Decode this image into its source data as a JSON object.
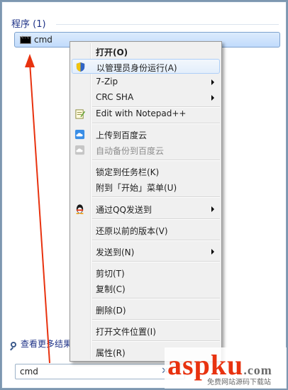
{
  "start_menu": {
    "section_header": "程序 (1)",
    "program_item": {
      "label": "cmd"
    },
    "see_more": "查看更多结果",
    "search": {
      "value": "cmd"
    }
  },
  "context_menu": {
    "items": [
      {
        "label": "打开(O)",
        "icon": "none",
        "submenu": false
      },
      {
        "label": "以管理员身份运行(A)",
        "icon": "uac-shield-icon",
        "submenu": false
      },
      {
        "label": "7-Zip",
        "icon": "none",
        "submenu": true
      },
      {
        "label": "CRC SHA",
        "icon": "none",
        "submenu": true
      },
      {
        "label": "Edit with Notepad++",
        "icon": "notepad-plus-plus-icon",
        "submenu": false
      },
      {
        "label": "上传到百度云",
        "icon": "baidu-cloud-icon",
        "submenu": false
      },
      {
        "label": "自动备份到百度云",
        "icon": "baidu-cloud-icon",
        "submenu": false
      },
      {
        "label": "锁定到任务栏(K)",
        "icon": "none",
        "submenu": false
      },
      {
        "label": "附到「开始」菜单(U)",
        "icon": "none",
        "submenu": false
      },
      {
        "label": "通过QQ发送到",
        "icon": "qq-penguin-icon",
        "submenu": true
      },
      {
        "label": "还原以前的版本(V)",
        "icon": "none",
        "submenu": false
      },
      {
        "label": "发送到(N)",
        "icon": "none",
        "submenu": true
      },
      {
        "label": "剪切(T)",
        "icon": "none",
        "submenu": false
      },
      {
        "label": "复制(C)",
        "icon": "none",
        "submenu": false
      },
      {
        "label": "删除(D)",
        "icon": "none",
        "submenu": false
      },
      {
        "label": "打开文件位置(I)",
        "icon": "none",
        "submenu": false
      },
      {
        "label": "属性(R)",
        "icon": "none",
        "submenu": false
      }
    ]
  },
  "watermark": {
    "brand": "aspku",
    "domain_suffix": ".com",
    "subtitle": "免费网站源码下载站"
  },
  "colors": {
    "accent_red": "#e8320f",
    "highlight_border": "#aecff7",
    "header_blue": "#1e3287"
  }
}
